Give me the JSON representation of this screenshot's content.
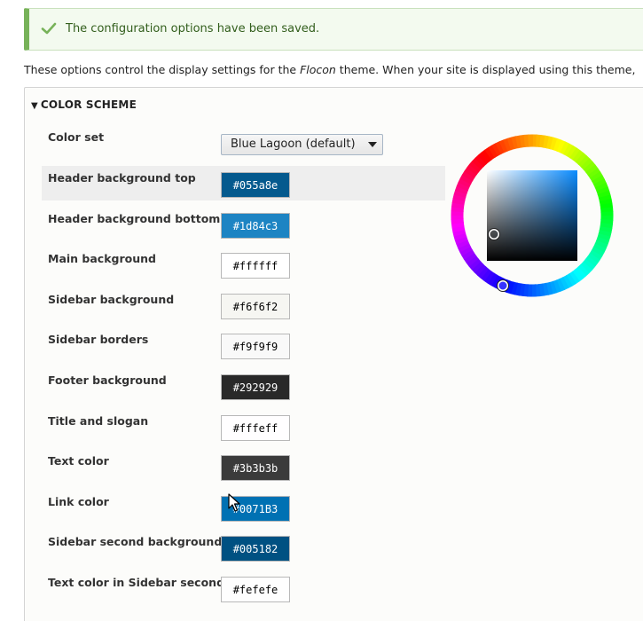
{
  "status": {
    "message": "The configuration options have been saved.",
    "icon": "checkmark-icon"
  },
  "intro": {
    "before": "These options control the display settings for the ",
    "theme": "Flocon",
    "after": " theme. When your site is displayed using this theme,"
  },
  "color_scheme": {
    "legend": "COLOR SCHEME",
    "color_set_label": "Color set",
    "color_set_value": "Blue Lagoon (default)",
    "fields": [
      {
        "label": "Header background top",
        "value": "#055a8e",
        "color": "#055a8e",
        "text_color": "#ffffff",
        "active": true
      },
      {
        "label": "Header background bottom",
        "value": "#1d84c3",
        "color": "#1d84c3",
        "text_color": "#ffffff"
      },
      {
        "label": "Main background",
        "value": "#ffffff",
        "color": "#ffffff",
        "text_color": "#000000"
      },
      {
        "label": "Sidebar background",
        "value": "#f6f6f2",
        "color": "#f6f6f2",
        "text_color": "#000000"
      },
      {
        "label": "Sidebar borders",
        "value": "#f9f9f9",
        "color": "#f9f9f9",
        "text_color": "#000000"
      },
      {
        "label": "Footer background",
        "value": "#292929",
        "color": "#292929",
        "text_color": "#ffffff"
      },
      {
        "label": "Title and slogan",
        "value": "#fffeff",
        "color": "#fffeff",
        "text_color": "#000000"
      },
      {
        "label": "Text color",
        "value": "#3b3b3b",
        "color": "#3b3b3b",
        "text_color": "#ffffff"
      },
      {
        "label": "Link color",
        "value": "#0071B3",
        "color": "#0071b3",
        "text_color": "#ffffff"
      },
      {
        "label": "Sidebar second background",
        "value": "#005182",
        "color": "#005182",
        "text_color": "#ffffff"
      },
      {
        "label": "Text color in Sidebar second",
        "value": "#fefefe",
        "color": "#fefefe",
        "text_color": "#000000"
      }
    ],
    "picker": {
      "hue_color": "#1d84c3",
      "icon": "color-wheel-icon"
    }
  }
}
